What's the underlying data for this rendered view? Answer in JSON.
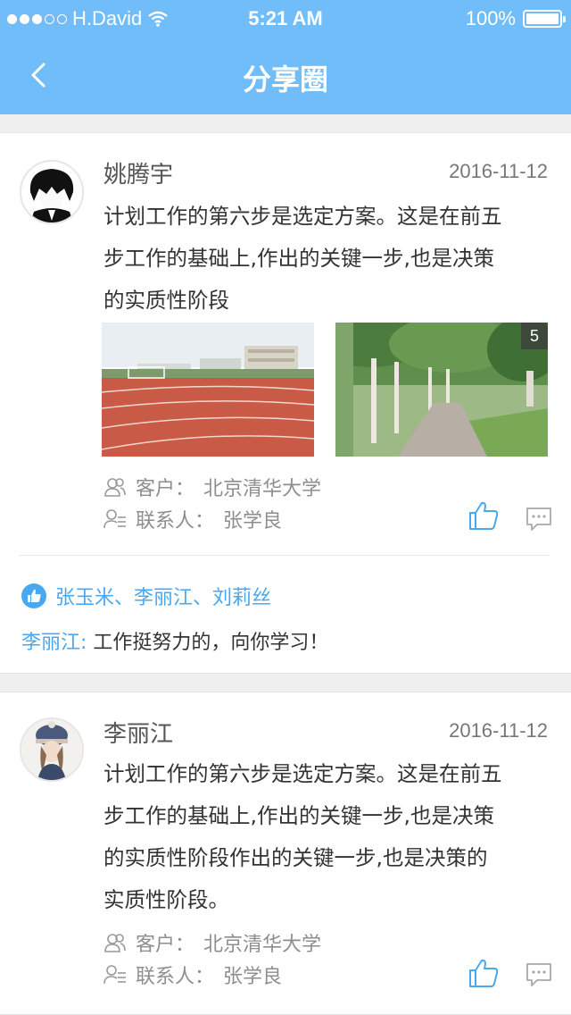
{
  "status_bar": {
    "carrier": "H.David",
    "time": "5:21 AM",
    "battery": "100%"
  },
  "header": {
    "title": "分享圈"
  },
  "colors": {
    "accent": "#71bdf9",
    "link": "#4aa8f0"
  },
  "posts": [
    {
      "author": "姚腾宇",
      "date": "2016-11-12",
      "content_lines": [
        "计划工作的第六步是选定方案。这是在前五",
        "步工作的基础上,作出的关键一步,也是决策",
        "的实质性阶段"
      ],
      "photo_count": "5",
      "customer_label": "客户：",
      "customer": "北京清华大学",
      "contact_label": "联系人：",
      "contact": "张学良",
      "likes": "张玉米、李丽江、刘莉丝",
      "comment": {
        "author": "李丽江:",
        "text": "工作挺努力的，向你学习！"
      }
    },
    {
      "author": "李丽江",
      "date": "2016-11-12",
      "content_lines": [
        "计划工作的第六步是选定方案。这是在前五",
        "步工作的基础上,作出的关键一步,也是决策",
        "的实质性阶段作出的关键一步,也是决策的",
        "实质性阶段。"
      ],
      "customer_label": "客户：",
      "customer": "北京清华大学",
      "contact_label": "联系人：",
      "contact": "张学良"
    }
  ]
}
